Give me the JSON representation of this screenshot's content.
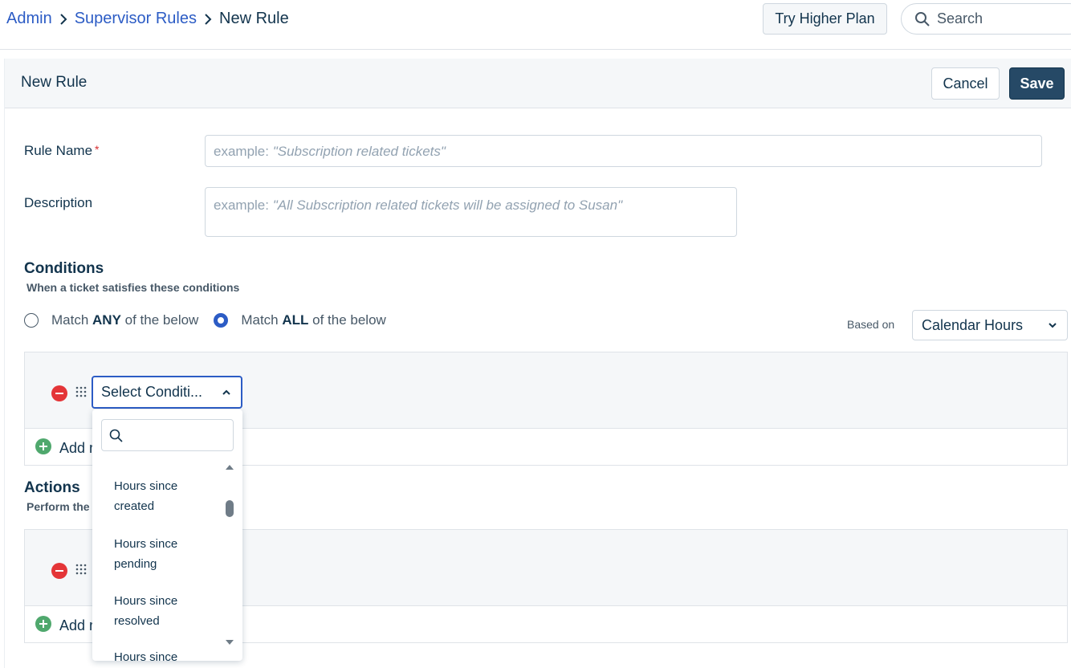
{
  "breadcrumb": {
    "items": [
      "Admin",
      "Supervisor Rules"
    ],
    "current": "New Rule"
  },
  "topbar": {
    "try_plan_label": "Try Higher Plan",
    "search_placeholder": "Search"
  },
  "header": {
    "title": "New Rule",
    "cancel_label": "Cancel",
    "save_label": "Save"
  },
  "form": {
    "rule_name_label": "Rule Name",
    "required_mark": "*",
    "rule_name_placeholder_prefix": "example: ",
    "rule_name_placeholder_example": "\"Subscription related tickets\"",
    "description_label": "Description",
    "description_placeholder_prefix": "example: ",
    "description_placeholder_example": "\"All Subscription related tickets will be assigned to Susan\""
  },
  "conditions": {
    "title": "Conditions",
    "subtitle": "When a ticket satisfies these conditions",
    "match_any_prefix": "Match ",
    "match_any_bold": "ANY",
    "match_any_suffix": " of the below",
    "match_all_prefix": "Match ",
    "match_all_bold": "ALL",
    "match_all_suffix": " of the below",
    "selected_match": "ALL",
    "based_on_label": "Based on",
    "based_on_value": "Calendar Hours",
    "condition_select_value": "Select Conditi...",
    "add_label_visible": "Add r"
  },
  "dropdown": {
    "search_value": "",
    "options": [
      {
        "line1": "Hours since",
        "line2": "created"
      },
      {
        "line1": "Hours since",
        "line2": "pending"
      },
      {
        "line1": "Hours since",
        "line2": "resolved"
      }
    ],
    "partial_option": "Hours since"
  },
  "actions": {
    "title": "Actions",
    "subtitle_visible": "Perform the",
    "add_label_visible": "Add r"
  },
  "colors": {
    "link": "#2c5cc5",
    "text": "#12344d",
    "save_bg": "#264966",
    "remove_icon": "#e43538",
    "add_icon": "#4fa86d",
    "required": "#d72d30"
  }
}
